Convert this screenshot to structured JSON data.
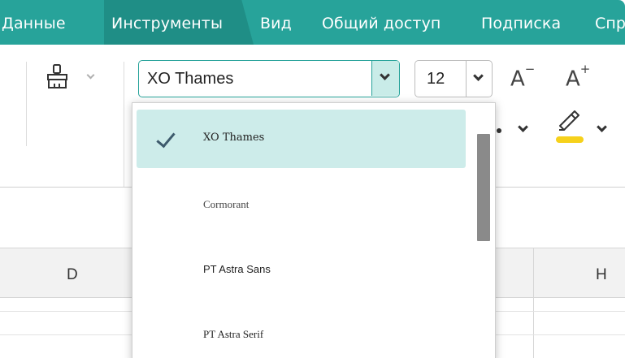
{
  "menu": {
    "items": [
      "Данные",
      "Инструменты",
      "Вид",
      "Общий доступ",
      "Подписка",
      "Спр"
    ],
    "active_index": 1,
    "background": "#27a39a"
  },
  "ribbon": {
    "format_painter_icon": "paint-brush-icon",
    "font_name": "XO Thames",
    "font_size": "12",
    "decrease_font_label": "A",
    "decrease_font_sign": "−",
    "increase_font_label": "A",
    "increase_font_sign": "+",
    "highlight_icon": "highlighter-icon",
    "highlight_color": "#f6d11b"
  },
  "font_dropdown": {
    "items": [
      {
        "label": "XO Thames",
        "selected": true
      },
      {
        "label": "Cormorant",
        "selected": false
      },
      {
        "label": "PT Astra Sans",
        "selected": false
      },
      {
        "label": "PT Astra Serif",
        "selected": false
      }
    ]
  },
  "sheet": {
    "columns": [
      "D",
      "H"
    ]
  },
  "colors": {
    "accent": "#27a39a",
    "selected_item": "#cdecea"
  }
}
